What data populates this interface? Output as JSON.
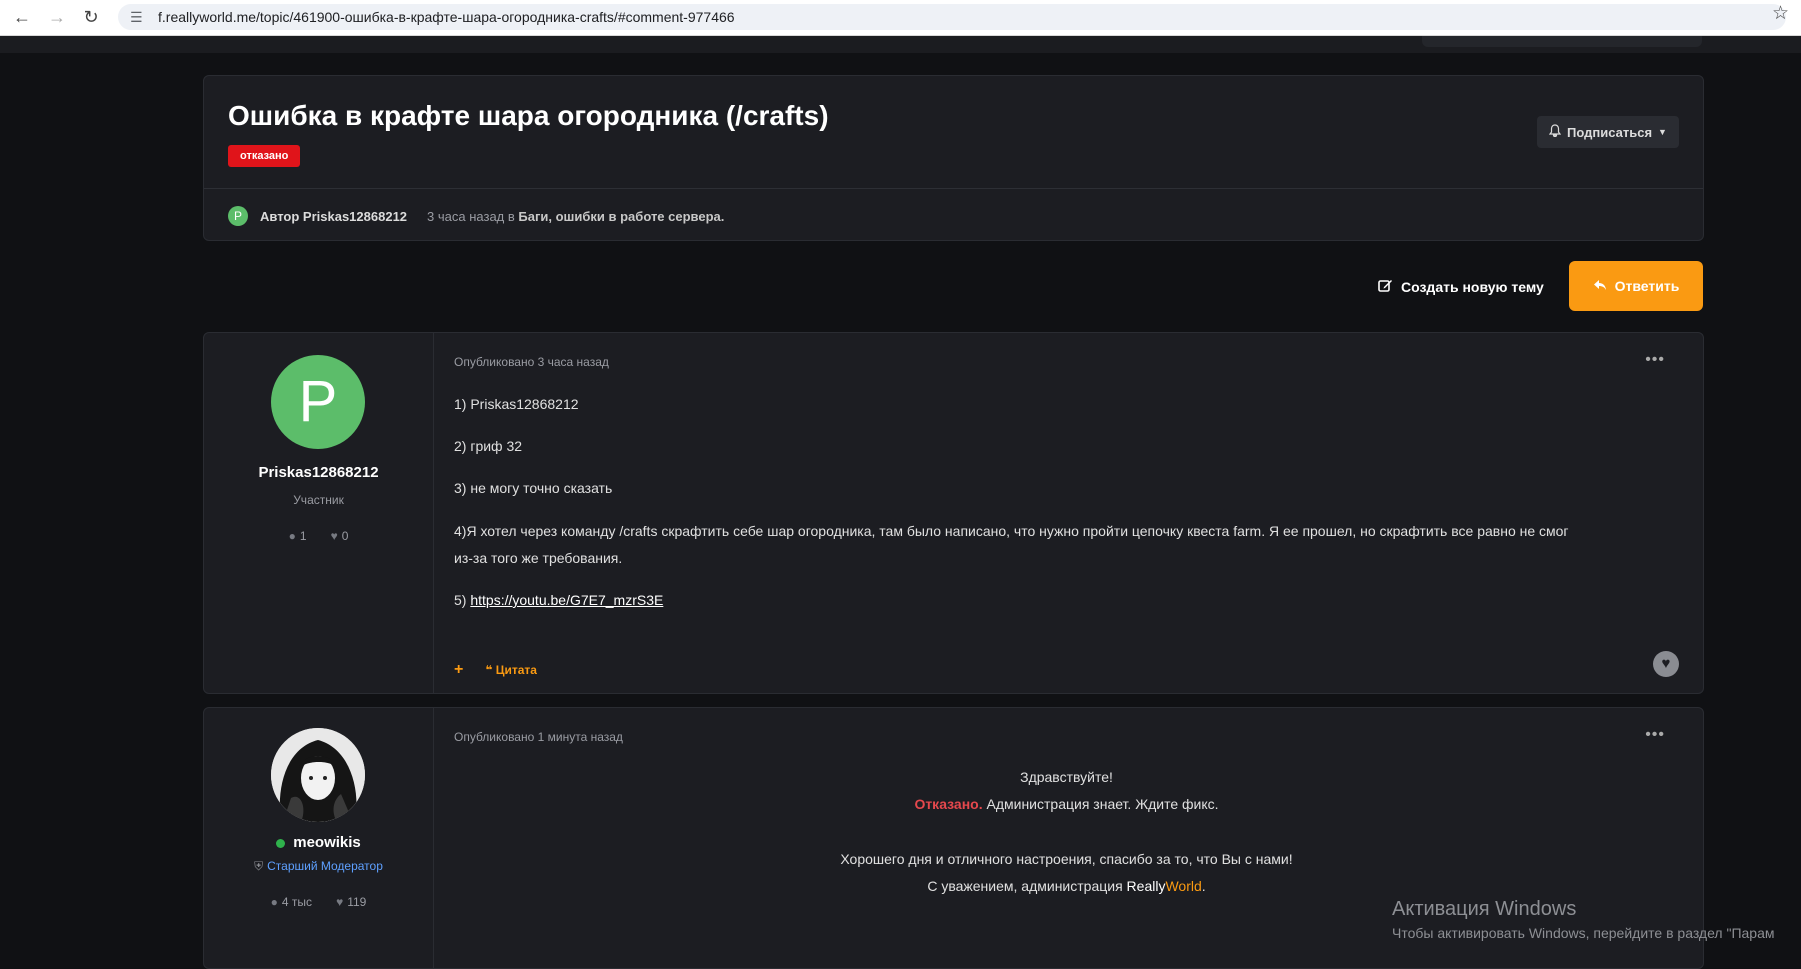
{
  "browser": {
    "url": "f.reallyworld.me/topic/461900-ошибка-в-крафте-шара-огородника-crafts/#comment-977466"
  },
  "topic": {
    "title": "Ошибка в крафте шара огородника (/crafts)",
    "status": "отказано",
    "follow_label": "Подписаться",
    "author_label": "Автор",
    "author": "Priskas12868212",
    "author_initial": "P",
    "meta_time": "3 часа назад в",
    "meta_forum": "Баги, ошибки в работе сервера."
  },
  "actions": {
    "new_topic": "Создать новую тему",
    "reply": "Ответить"
  },
  "posts": [
    {
      "author": "Priskas12868212",
      "initial": "P",
      "role": "Участник",
      "posts_count": "1",
      "reputation": "0",
      "published": "Опубликовано 3 часа назад",
      "lines": [
        "1) Priskas12868212",
        "2) гриф 32",
        "3) не могу точно сказать",
        "4)Я хотел через команду /crafts скрафтить себе шар огородника, там было написано, что нужно пройти цепочку квеста farm. Я ее прошел, но скрафтить все равно не смог",
        "из-за того же требования."
      ],
      "link_prefix": "5)",
      "link_text": "https://youtu.be/G7E7_mzrS3E",
      "plus": "+",
      "quote": "Цитата"
    },
    {
      "author": "meowikis",
      "role": "Старший Модератор",
      "posts_count": "4 тыс",
      "reputation": "119",
      "published": "Опубликовано 1 минута назад",
      "greeting": "Здравствуйте!",
      "denied": "Отказано.",
      "denied_rest": "Администрация знает. Ждите фикс.",
      "wish": "Хорошего дня и отличного настроения, спасибо за то, что Вы с нами!",
      "sign_prefix": "С уважением, администрация",
      "brand_a": "Really",
      "brand_b": "World",
      "sign_suffix": "."
    }
  ],
  "watermark": {
    "line1": "Активация Windows",
    "line2": "Чтобы активировать Windows, перейдите в раздел \"Парам"
  },
  "colors": {
    "accent": "#fa9a12",
    "badge": "#e0141a",
    "background": "#101114",
    "card": "#1c1d22"
  }
}
